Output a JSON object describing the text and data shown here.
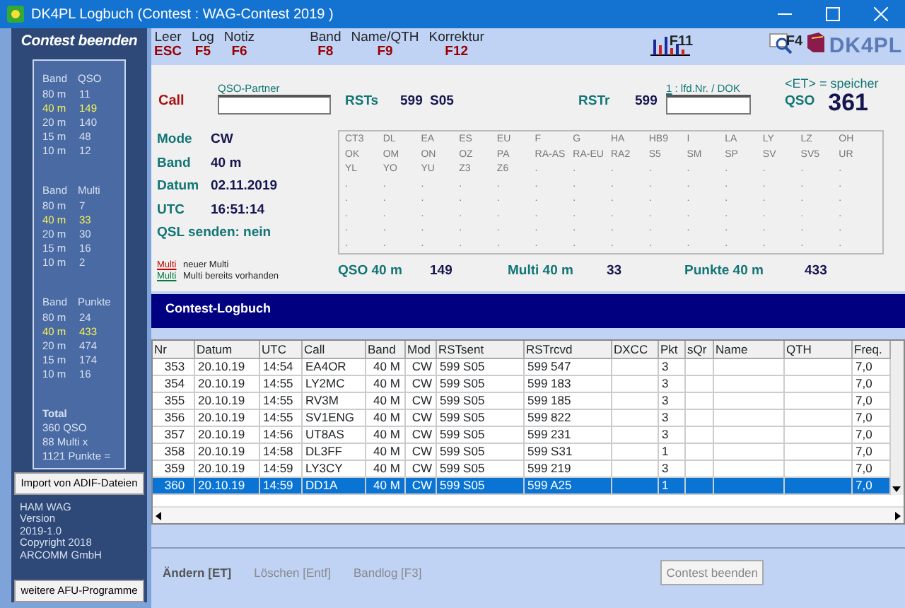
{
  "window": {
    "title": "DK4PL  Logbuch (Contest : WAG-Contest 2019 )"
  },
  "sidebar": {
    "title": "Contest beenden",
    "stat_groups": [
      {
        "columns": [
          "Band",
          "QSO"
        ],
        "rows": [
          {
            "band": "80 m",
            "value": "11",
            "selected": false
          },
          {
            "band": "40 m",
            "value": "149",
            "selected": true
          },
          {
            "band": "20 m",
            "value": "140",
            "selected": false
          },
          {
            "band": "15 m",
            "value": "48",
            "selected": false
          },
          {
            "band": "10 m",
            "value": "12",
            "selected": false
          }
        ]
      },
      {
        "columns": [
          "Band",
          "Multi"
        ],
        "rows": [
          {
            "band": "80 m",
            "value": "7",
            "selected": false
          },
          {
            "band": "40 m",
            "value": "33",
            "selected": true
          },
          {
            "band": "20 m",
            "value": "30",
            "selected": false
          },
          {
            "band": "15 m",
            "value": "16",
            "selected": false
          },
          {
            "band": "10 m",
            "value": "2",
            "selected": false
          }
        ]
      },
      {
        "columns": [
          "Band",
          "Punkte"
        ],
        "rows": [
          {
            "band": "80 m",
            "value": "24",
            "selected": false
          },
          {
            "band": "40 m",
            "value": "433",
            "selected": true
          },
          {
            "band": "20 m",
            "value": "474",
            "selected": false
          },
          {
            "band": "15 m",
            "value": "174",
            "selected": false
          },
          {
            "band": "10 m",
            "value": "16",
            "selected": false
          }
        ]
      }
    ],
    "total": [
      "Total",
      "360 QSO",
      "88 Multi x",
      "1121 Punkte ="
    ],
    "import_button": "Import von ADIF-Dateien",
    "about": [
      "HAM WAG",
      "Version",
      "2019-1.0",
      "Copyright 2018",
      "ARCOMM GmbH"
    ],
    "more_button": "weitere AFU-Programme"
  },
  "toolbar": {
    "items": [
      {
        "label": "Leer",
        "key": "ESC"
      },
      {
        "label": "Log",
        "key": "F5"
      },
      {
        "label": "Notiz",
        "key": "F6"
      },
      {
        "label": "Band",
        "key": "F8"
      },
      {
        "label": "Name/QTH",
        "key": "F9"
      },
      {
        "label": "Korrektur",
        "key": "F12"
      }
    ],
    "chart_key": "F11",
    "search_key": "F4",
    "logo": "DK4PL"
  },
  "entry": {
    "call_label": "Call",
    "call_hint": "QSO-Partner",
    "rsts_label": "RSTs",
    "rsts_value": "599",
    "rsts_serial": "S05",
    "rstr_label": "RSTr",
    "rstr_value": "599",
    "rstr_hint_key": "1",
    "rstr_hint": " : lfd.Nr. / DOK",
    "save_hint": "<ET> = speicher",
    "qso_label": "QSO",
    "qso_number": "361"
  },
  "info": [
    {
      "label": "Mode",
      "value": "CW"
    },
    {
      "label": "Band",
      "value": "40 m"
    },
    {
      "label": "Datum",
      "value": "02.11.2019"
    },
    {
      "label": "UTC",
      "value": "16:51:14"
    }
  ],
  "qsl": "QSL senden: nein",
  "multi_grid": [
    [
      "CT3",
      "DL",
      "EA",
      "ES",
      "EU",
      "F",
      "G",
      "HA",
      "HB9",
      "I",
      "LA",
      "LY",
      "LZ",
      "OH"
    ],
    [
      "OK",
      "OM",
      "ON",
      "OZ",
      "PA",
      "RA-AS",
      "RA-EU",
      "RA2",
      "S5",
      "SM",
      "SP",
      "SV",
      "SV5",
      "UR"
    ],
    [
      "YL",
      "YO",
      "YU",
      "Z3",
      "Z6",
      ".",
      ".",
      ".",
      ".",
      ".",
      ".",
      ".",
      ".",
      "."
    ],
    [
      ".",
      ".",
      ".",
      ".",
      ".",
      ".",
      ".",
      ".",
      ".",
      ".",
      ".",
      ".",
      ".",
      "."
    ],
    [
      ".",
      ".",
      ".",
      ".",
      ".",
      ".",
      ".",
      ".",
      ".",
      ".",
      ".",
      ".",
      ".",
      "."
    ],
    [
      ".",
      ".",
      ".",
      ".",
      ".",
      ".",
      ".",
      ".",
      ".",
      ".",
      ".",
      ".",
      ".",
      "."
    ],
    [
      ".",
      ".",
      ".",
      ".",
      ".",
      ".",
      ".",
      ".",
      ".",
      ".",
      ".",
      ".",
      ".",
      "."
    ],
    [
      ".",
      ".",
      ".",
      ".",
      ".",
      ".",
      ".",
      ".",
      ".",
      ".",
      ".",
      ".",
      ".",
      "."
    ]
  ],
  "legend": [
    {
      "mark": "Multi",
      "color": "#cc0000",
      "text": "neuer Multi"
    },
    {
      "mark": "Multi",
      "color": "#007a3d",
      "text": "Multi bereits vorhanden"
    }
  ],
  "band_stats": [
    {
      "label": "QSO 40 m",
      "value": "149"
    },
    {
      "label": "Multi 40 m",
      "value": "33"
    },
    {
      "label": "Punkte 40 m",
      "value": "433"
    }
  ],
  "log_title": "Contest-Logbuch",
  "table": {
    "columns": [
      "Nr",
      "Datum",
      "UTC",
      "Call",
      "Band",
      "Mod",
      "RSTsent",
      "RSTrcvd",
      "DXCC",
      "Pkt",
      "sQr",
      "Name",
      "QTH",
      "Freq."
    ],
    "rows": [
      {
        "selected": false,
        "cells": [
          "353",
          "20.10.19",
          "14:54",
          "EA4OR",
          "40 M",
          "CW",
          "599  S05",
          "599  547",
          "",
          "3",
          "",
          "",
          "",
          "7,0"
        ]
      },
      {
        "selected": false,
        "cells": [
          "354",
          "20.10.19",
          "14:55",
          "LY2MC",
          "40 M",
          "CW",
          "599  S05",
          "599  183",
          "",
          "3",
          "",
          "",
          "",
          "7,0"
        ]
      },
      {
        "selected": false,
        "cells": [
          "355",
          "20.10.19",
          "14:55",
          "RV3M",
          "40 M",
          "CW",
          "599  S05",
          "599  185",
          "",
          "3",
          "",
          "",
          "",
          "7,0"
        ]
      },
      {
        "selected": false,
        "cells": [
          "356",
          "20.10.19",
          "14:55",
          "SV1ENG",
          "40 M",
          "CW",
          "599  S05",
          "599  822",
          "",
          "3",
          "",
          "",
          "",
          "7,0"
        ]
      },
      {
        "selected": false,
        "cells": [
          "357",
          "20.10.19",
          "14:56",
          "UT8AS",
          "40 M",
          "CW",
          "599  S05",
          "599  231",
          "",
          "3",
          "",
          "",
          "",
          "7,0"
        ]
      },
      {
        "selected": false,
        "cells": [
          "358",
          "20.10.19",
          "14:58",
          "DL3FF",
          "40 M",
          "CW",
          "599  S05",
          "599  S31",
          "",
          "1",
          "",
          "",
          "",
          "7,0"
        ]
      },
      {
        "selected": false,
        "cells": [
          "359",
          "20.10.19",
          "14:59",
          "LY3CY",
          "40 M",
          "CW",
          "599  S05",
          "599  219",
          "",
          "3",
          "",
          "",
          "",
          "7,0"
        ]
      },
      {
        "selected": true,
        "cells": [
          "360",
          "20.10.19",
          "14:59",
          "DD1A",
          "40 M",
          "CW",
          "599  S05",
          "599  A25",
          "",
          "1",
          "",
          "",
          "",
          "7,0"
        ]
      }
    ]
  },
  "actions": [
    {
      "label": "Ändern [ET]",
      "kind": "link",
      "disabled": false
    },
    {
      "label": "Löschen [Entf]",
      "kind": "link",
      "disabled": true
    },
    {
      "label": "Bandlog [F3]",
      "kind": "link",
      "disabled": true
    },
    {
      "label": "Contest beenden",
      "kind": "button",
      "disabled": true
    }
  ]
}
